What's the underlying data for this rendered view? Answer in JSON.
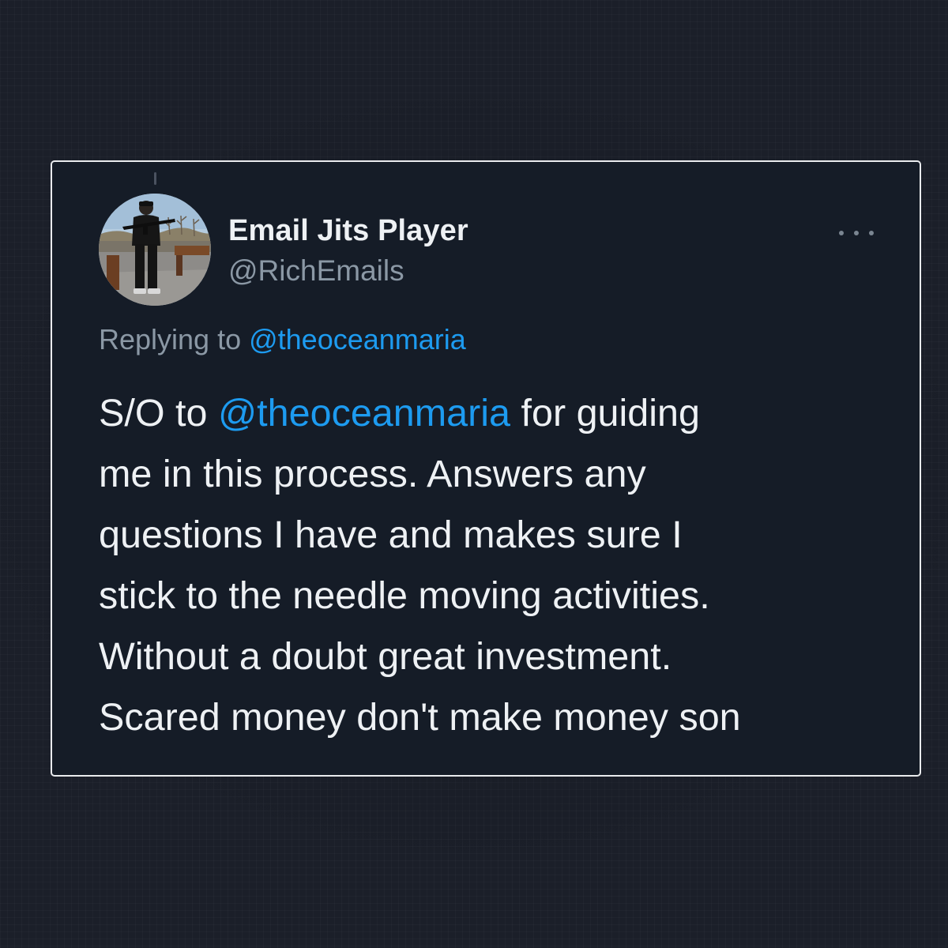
{
  "tweet": {
    "author": {
      "display_name": "Email Jits Player",
      "handle": "@RichEmails",
      "avatar_icon": "profile-photo"
    },
    "more_icon": "more-horizontal-icon",
    "replying_to": {
      "prefix": "Replying to ",
      "mention": "@theoceanmaria"
    },
    "body": {
      "line1_prefix": "S/O to ",
      "line1_mention": "@theoceanmaria",
      "line1_suffix": " for guiding",
      "line2": "me in this process. Answers any",
      "line3": "questions I have and makes sure I",
      "line4": "stick to the needle moving activities.",
      "line5": "Without a doubt great investment.",
      "line6": "Scared money don't make money son"
    }
  },
  "colors": {
    "background": "#1b1f29",
    "card": "#151c27",
    "card_border": "#e9ebee",
    "text_primary": "#eef1f4",
    "text_secondary": "#8b98a5",
    "link": "#1d9bf0"
  }
}
